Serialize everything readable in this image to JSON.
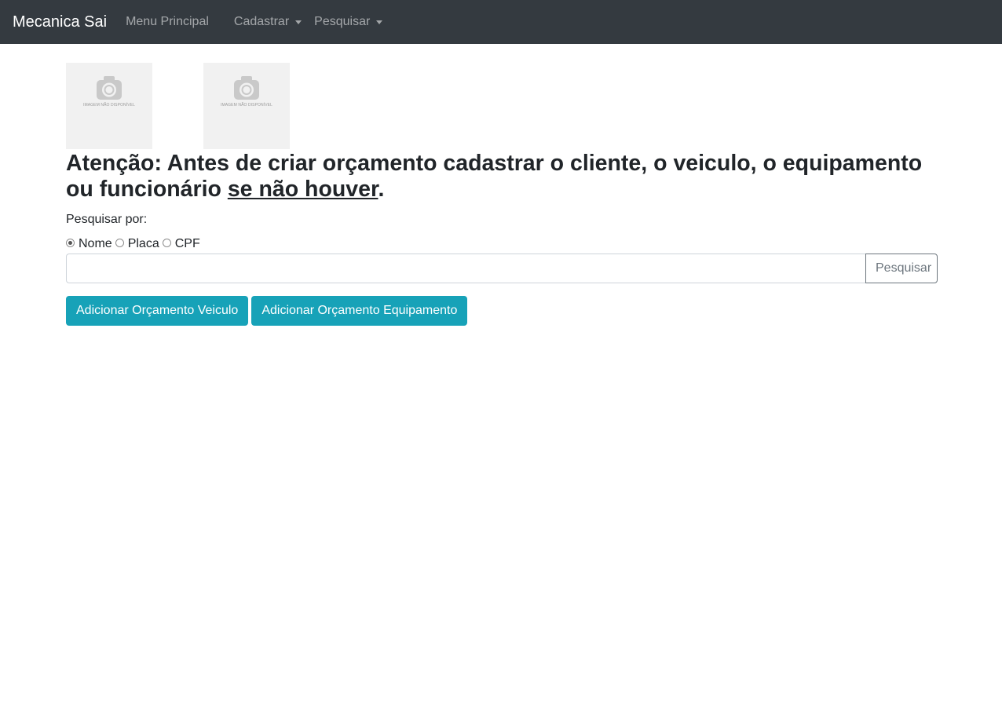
{
  "navbar": {
    "brand": "Mecanica Sai",
    "links": [
      {
        "label": "Menu Principal"
      },
      {
        "label": "Cadastrar"
      },
      {
        "label": "Pesquisar"
      }
    ],
    "background": "#343a40"
  },
  "thumbnails": [
    {
      "caption": "IMAGEM NÃO DISPONÍVEL",
      "icon": "camera-icon"
    },
    {
      "caption": "IMAGEM NÃO DISPONÍVEL",
      "icon": "camera-icon"
    }
  ],
  "warning": {
    "text": "Atenção: Antes de criar orçamento cadastrar o cliente, o veiculo, o equipamento ou funcionário ",
    "emphasis": "se não houver",
    "suffix": "."
  },
  "search": {
    "label": "Pesquisar por:",
    "options": [
      {
        "label": "Nome",
        "checked": true
      },
      {
        "label": "Placa",
        "checked": false
      },
      {
        "label": "CPF",
        "checked": false
      }
    ],
    "input_value": "",
    "button_label": "Pesquisar"
  },
  "actions": {
    "add_vehicle_label": "Adicionar Orçamento Veiculo",
    "add_equipment_label": "Adicionar Orçamento Equipamento",
    "color": "#17a2b8"
  }
}
